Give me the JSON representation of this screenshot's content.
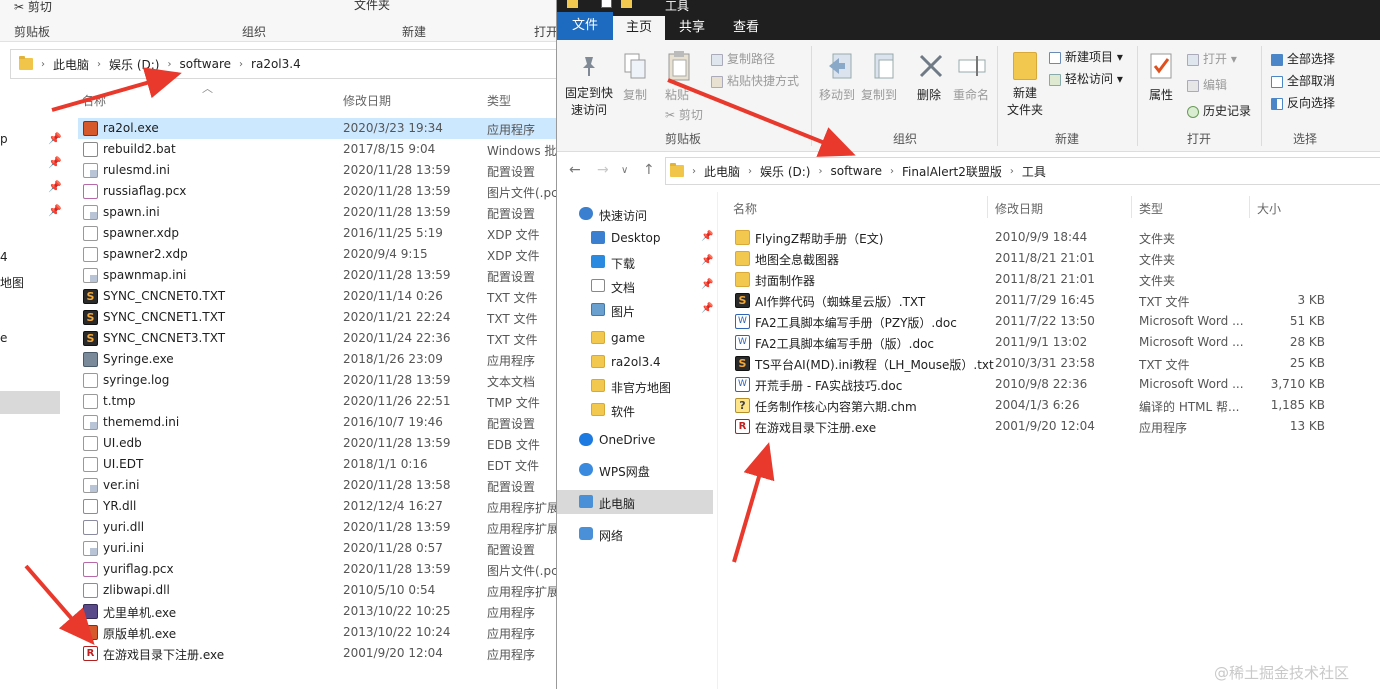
{
  "left_window": {
    "ribbon": {
      "cut": "剪切",
      "clipboard_group": "剪贴板",
      "organize_group": "组织",
      "new_group": "新建",
      "open_group": "打开",
      "file_clip": "文件夹"
    },
    "address": [
      "此电脑",
      "娱乐 (D:)",
      "software",
      "ra2ol3.4"
    ],
    "columns": {
      "name": "名称",
      "date": "修改日期",
      "type": "类型"
    },
    "nav_fragments": [
      "p",
      "4",
      "地图",
      "e"
    ],
    "files": [
      {
        "name": "ra2ol.exe",
        "date": "2020/3/23 19:34",
        "type": "应用程序",
        "icon": "exe"
      },
      {
        "name": "rebuild2.bat",
        "date": "2017/8/15 9:04",
        "type": "Windows 批",
        "icon": "bat"
      },
      {
        "name": "rulesmd.ini",
        "date": "2020/11/28 13:59",
        "type": "配置设置",
        "icon": "ini"
      },
      {
        "name": "russiaflag.pcx",
        "date": "2020/11/28 13:59",
        "type": "图片文件(.pc",
        "icon": "img"
      },
      {
        "name": "spawn.ini",
        "date": "2020/11/28 13:59",
        "type": "配置设置",
        "icon": "ini"
      },
      {
        "name": "spawner.xdp",
        "date": "2016/11/25 5:19",
        "type": "XDP 文件",
        "icon": "doc"
      },
      {
        "name": "spawner2.xdp",
        "date": "2020/9/4 9:15",
        "type": "XDP 文件",
        "icon": "doc"
      },
      {
        "name": "spawnmap.ini",
        "date": "2020/11/28 13:59",
        "type": "配置设置",
        "icon": "ini"
      },
      {
        "name": "SYNC_CNCNET0.TXT",
        "date": "2020/11/14 0:26",
        "type": "TXT 文件",
        "icon": "txt"
      },
      {
        "name": "SYNC_CNCNET1.TXT",
        "date": "2020/11/21 22:24",
        "type": "TXT 文件",
        "icon": "txt"
      },
      {
        "name": "SYNC_CNCNET3.TXT",
        "date": "2020/11/24 22:36",
        "type": "TXT 文件",
        "icon": "txt"
      },
      {
        "name": "Syringe.exe",
        "date": "2018/1/26 23:09",
        "type": "应用程序",
        "icon": "syr"
      },
      {
        "name": "syringe.log",
        "date": "2020/11/28 13:59",
        "type": "文本文档",
        "icon": "doc"
      },
      {
        "name": "t.tmp",
        "date": "2020/11/26 22:51",
        "type": "TMP 文件",
        "icon": "doc"
      },
      {
        "name": "thememd.ini",
        "date": "2016/10/7 19:46",
        "type": "配置设置",
        "icon": "ini"
      },
      {
        "name": "UI.edb",
        "date": "2020/11/28 13:59",
        "type": "EDB 文件",
        "icon": "doc"
      },
      {
        "name": "UI.EDT",
        "date": "2018/1/1 0:16",
        "type": "EDT 文件",
        "icon": "doc"
      },
      {
        "name": "ver.ini",
        "date": "2020/11/28 13:58",
        "type": "配置设置",
        "icon": "ini"
      },
      {
        "name": "YR.dll",
        "date": "2012/12/4 16:27",
        "type": "应用程序扩展",
        "icon": "dll"
      },
      {
        "name": "yuri.dll",
        "date": "2020/11/28 13:59",
        "type": "应用程序扩展",
        "icon": "dll"
      },
      {
        "name": "yuri.ini",
        "date": "2020/11/28 0:57",
        "type": "配置设置",
        "icon": "ini"
      },
      {
        "name": "yuriflag.pcx",
        "date": "2020/11/28 13:59",
        "type": "图片文件(.pc",
        "icon": "img"
      },
      {
        "name": "zlibwapi.dll",
        "date": "2010/5/10 0:54",
        "type": "应用程序扩展",
        "icon": "dll"
      },
      {
        "name": "尤里单机.exe",
        "date": "2013/10/22 10:25",
        "type": "应用程序",
        "icon": "yuri"
      },
      {
        "name": "原版单机.exe",
        "date": "2013/10/22 10:24",
        "type": "应用程序",
        "icon": "exe"
      },
      {
        "name": "在游戏目录下注册.exe",
        "date": "2001/9/20 12:04",
        "type": "应用程序",
        "icon": "reg"
      }
    ]
  },
  "right_window": {
    "title": "工具",
    "tabs": {
      "file": "文件",
      "home": "主页",
      "share": "共享",
      "view": "查看"
    },
    "ribbon": {
      "pin": "固定到快",
      "pin2": "速访问",
      "copy": "复制",
      "paste": "粘贴",
      "cut": "剪切",
      "copy_path": "复制路径",
      "paste_shortcut": "粘贴快捷方式",
      "clipboard_group": "剪贴板",
      "move_to": "移动到",
      "copy_to": "复制到",
      "delete": "删除",
      "rename": "重命名",
      "organize_group": "组织",
      "new_folder": "新建",
      "new_folder2": "文件夹",
      "new_item": "新建项目",
      "easy_access": "轻松访问",
      "new_group": "新建",
      "properties": "属性",
      "open": "打开",
      "edit": "编辑",
      "history": "历史记录",
      "open_group": "打开",
      "select_all": "全部选择",
      "select_none": "全部取消",
      "invert": "反向选择",
      "select_group": "选择"
    },
    "address": [
      "此电脑",
      "娱乐 (D:)",
      "software",
      "FinalAlert2联盟版",
      "工具"
    ],
    "nav": [
      {
        "label": "快速访问",
        "icon": "star",
        "pin": false
      },
      {
        "label": "Desktop",
        "icon": "desktop",
        "pin": true
      },
      {
        "label": "下载",
        "icon": "download",
        "pin": true
      },
      {
        "label": "文档",
        "icon": "doc",
        "pin": true
      },
      {
        "label": "图片",
        "icon": "picture",
        "pin": true
      },
      {
        "label": "game",
        "icon": "folder",
        "pin": false
      },
      {
        "label": "ra2ol3.4",
        "icon": "folder",
        "pin": false
      },
      {
        "label": "非官方地图",
        "icon": "folder",
        "pin": false
      },
      {
        "label": "软件",
        "icon": "folder",
        "pin": false
      },
      {
        "label": "OneDrive",
        "icon": "cloud",
        "pin": false
      },
      {
        "label": "WPS网盘",
        "icon": "wps",
        "pin": false
      },
      {
        "label": "此电脑",
        "icon": "pc",
        "pin": false
      },
      {
        "label": "网络",
        "icon": "network",
        "pin": false
      }
    ],
    "columns": {
      "name": "名称",
      "date": "修改日期",
      "type": "类型",
      "size": "大小"
    },
    "files": [
      {
        "name": "FlyingZ帮助手册（E文)",
        "date": "2010/9/9 18:44",
        "type": "文件夹",
        "size": "",
        "icon": "folder"
      },
      {
        "name": "地图全息截图器",
        "date": "2011/8/21 21:01",
        "type": "文件夹",
        "size": "",
        "icon": "folder"
      },
      {
        "name": "封面制作器",
        "date": "2011/8/21 21:01",
        "type": "文件夹",
        "size": "",
        "icon": "folder"
      },
      {
        "name": "AI作弊代码（蜘蛛星云版）.TXT",
        "date": "2011/7/29 16:45",
        "type": "TXT 文件",
        "size": "3 KB",
        "icon": "txt"
      },
      {
        "name": "FA2工具脚本编写手册（PZY版）.doc",
        "date": "2011/7/22 13:50",
        "type": "Microsoft Word ...",
        "size": "51 KB",
        "icon": "word"
      },
      {
        "name": "FA2工具脚本编写手册（版）.doc",
        "date": "2011/9/1 13:02",
        "type": "Microsoft Word ...",
        "size": "28 KB",
        "icon": "word"
      },
      {
        "name": "TS平台AI(MD).ini教程（LH_Mouse版）.txt",
        "date": "2010/3/31 23:58",
        "type": "TXT 文件",
        "size": "25 KB",
        "icon": "txt"
      },
      {
        "name": "开荒手册 - FA实战技巧.doc",
        "date": "2010/9/8 22:36",
        "type": "Microsoft Word ...",
        "size": "3,710 KB",
        "icon": "word"
      },
      {
        "name": "任务制作核心内容第六期.chm",
        "date": "2004/1/3 6:26",
        "type": "编译的 HTML 帮...",
        "size": "1,185 KB",
        "icon": "chm"
      },
      {
        "name": "在游戏目录下注册.exe",
        "date": "2001/9/20 12:04",
        "type": "应用程序",
        "size": "13 KB",
        "icon": "reg"
      }
    ]
  },
  "watermark": "@稀土掘金技术社区",
  "colors": {
    "arrow": "#e8392c",
    "file_tab": "#1d6ac1",
    "selection": "#cce8ff",
    "titlebar": "#1f1f1f"
  }
}
